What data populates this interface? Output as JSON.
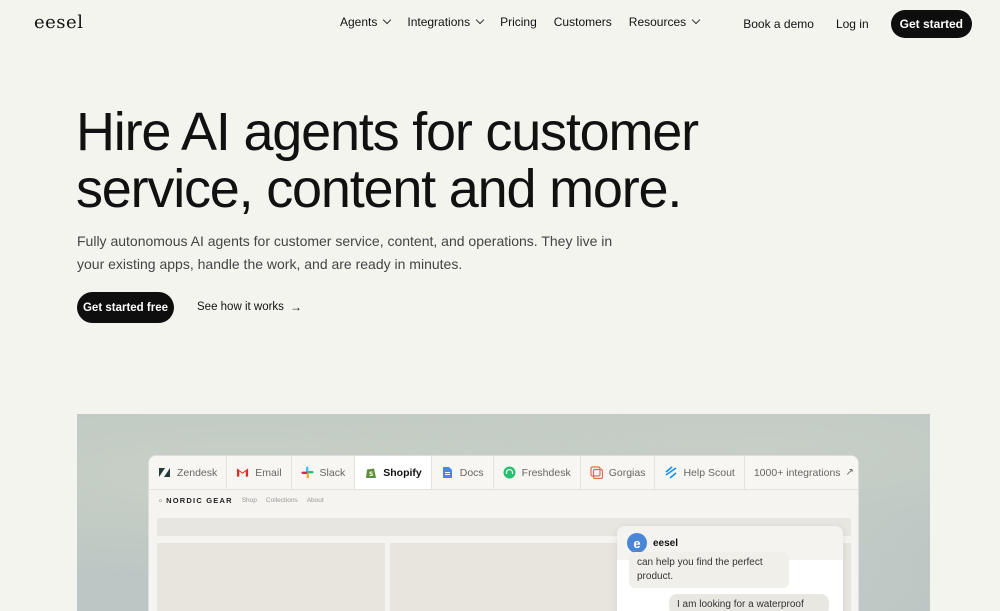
{
  "nav": {
    "logo": "eesel",
    "menu": [
      {
        "label": "Agents",
        "has_dropdown": true
      },
      {
        "label": "Integrations",
        "has_dropdown": true
      },
      {
        "label": "Pricing",
        "has_dropdown": false
      },
      {
        "label": "Customers",
        "has_dropdown": false
      },
      {
        "label": "Resources",
        "has_dropdown": true
      }
    ],
    "book_demo": "Book a demo",
    "login": "Log in",
    "get_started": "Get started"
  },
  "hero": {
    "title_line1": "Hire AI agents for customer",
    "title_line2": "service, content and more.",
    "subtitle": "Fully autonomous AI agents for customer service, content, and operations. They live in your existing apps, handle the work, and are ready in minutes.",
    "cta_primary": "Get started free",
    "cta_secondary": "See how it works",
    "cta_secondary_icon": "arrow-right-icon"
  },
  "showcase": {
    "tabs": [
      {
        "label": "Zendesk",
        "icon": "zendesk-icon",
        "color": "#1f3b3a",
        "active": false
      },
      {
        "label": "Email",
        "icon": "gmail-icon",
        "color": "#d93025",
        "active": false
      },
      {
        "label": "Slack",
        "icon": "slack-icon",
        "color": "#e01e5a",
        "active": false
      },
      {
        "label": "Shopify",
        "icon": "shopify-icon",
        "color": "#5e8e3e",
        "active": true
      },
      {
        "label": "Docs",
        "icon": "docs-icon",
        "color": "#4285f4",
        "active": false
      },
      {
        "label": "Freshdesk",
        "icon": "freshdesk-icon",
        "color": "#25c16f",
        "active": false
      },
      {
        "label": "Gorgias",
        "icon": "gorgias-icon",
        "color": "#e06b55",
        "active": false
      },
      {
        "label": "Help Scout",
        "icon": "helpscout-icon",
        "color": "#1292ee",
        "active": false
      }
    ],
    "integrations_link": "1000+ integrations",
    "integrations_icon": "arrow-up-right-icon",
    "shop": {
      "brand": "NORDIC GEAR",
      "links": [
        "Shop",
        "Collections",
        "About"
      ]
    },
    "chat": {
      "name": "eesel",
      "agent_message": "can help you find the perfect product.",
      "user_message": "I am looking for a waterproof"
    }
  }
}
